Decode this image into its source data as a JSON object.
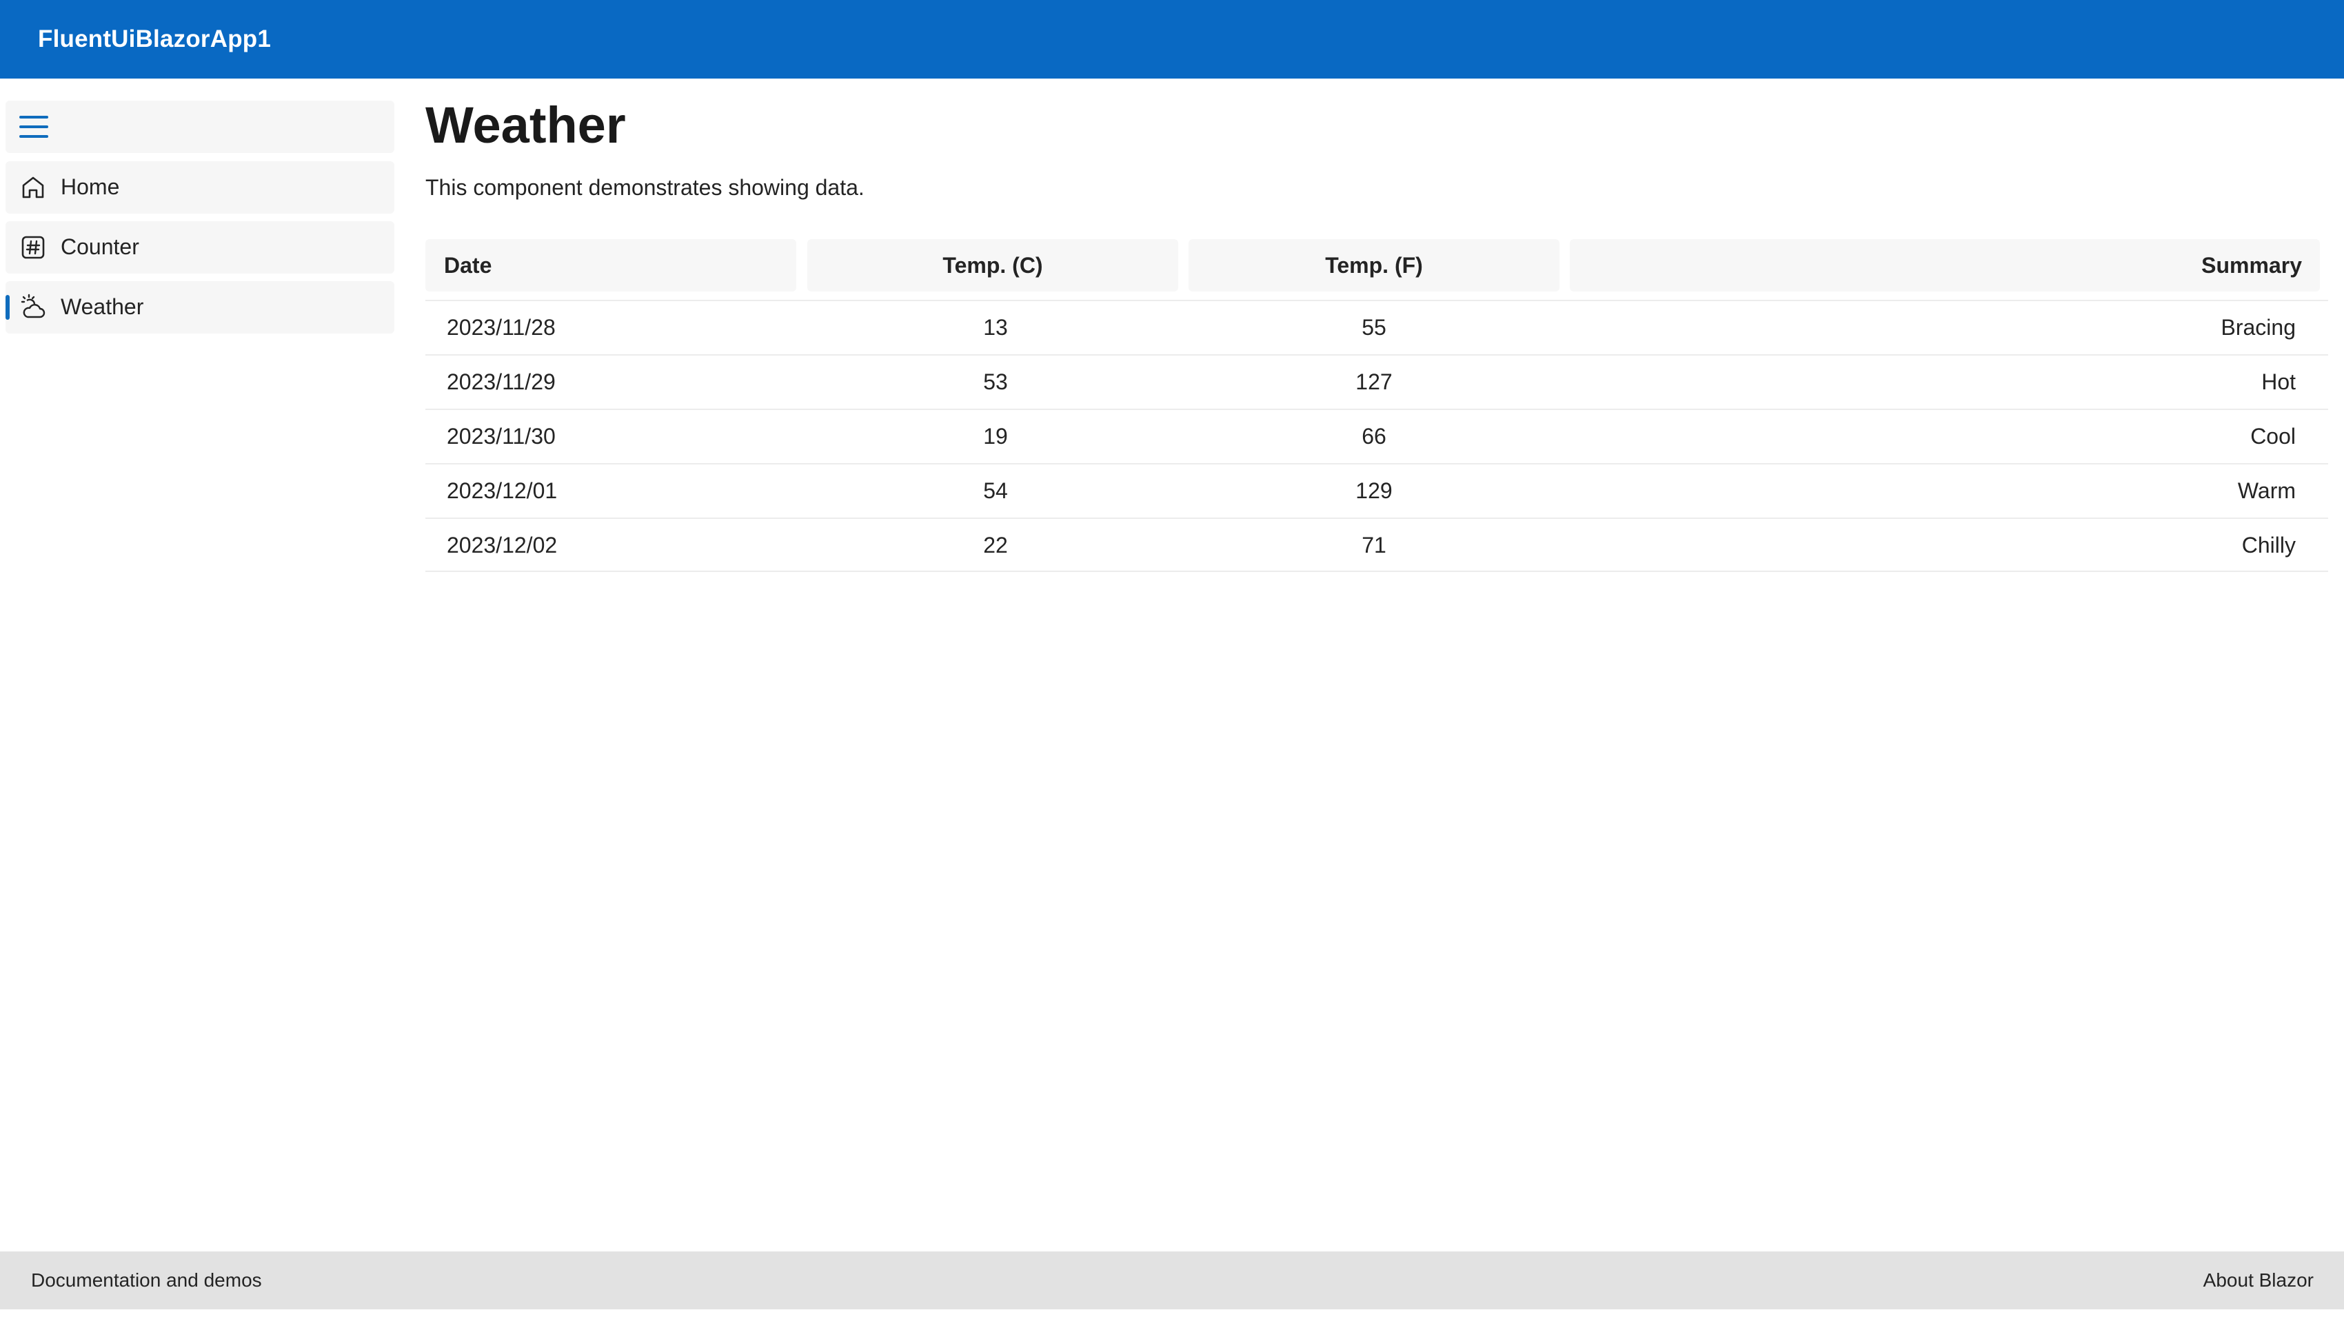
{
  "header": {
    "title": "FluentUiBlazorApp1"
  },
  "sidebar": {
    "toggle_icon": "hamburger-menu-icon",
    "items": [
      {
        "label": "Home",
        "icon": "home-icon",
        "active": false
      },
      {
        "label": "Counter",
        "icon": "number-symbol-icon",
        "active": false
      },
      {
        "label": "Weather",
        "icon": "weather-partly-cloudy-icon",
        "active": true
      }
    ]
  },
  "main": {
    "title": "Weather",
    "description": "This component demonstrates showing data.",
    "table": {
      "columns": [
        "Date",
        "Temp. (C)",
        "Temp. (F)",
        "Summary"
      ],
      "rows": [
        [
          "2023/11/28",
          "13",
          "55",
          "Bracing"
        ],
        [
          "2023/11/29",
          "53",
          "127",
          "Hot"
        ],
        [
          "2023/11/30",
          "19",
          "66",
          "Cool"
        ],
        [
          "2023/12/01",
          "54",
          "129",
          "Warm"
        ],
        [
          "2023/12/02",
          "22",
          "71",
          "Chilly"
        ]
      ]
    }
  },
  "footer": {
    "left_link": "Documentation and demos",
    "right_link": "About Blazor"
  },
  "colors": {
    "header_bg": "#0969c3",
    "accent": "#0f6cbd",
    "footer_bg": "#e2e2e2",
    "nav_bg": "#f6f6f6"
  }
}
